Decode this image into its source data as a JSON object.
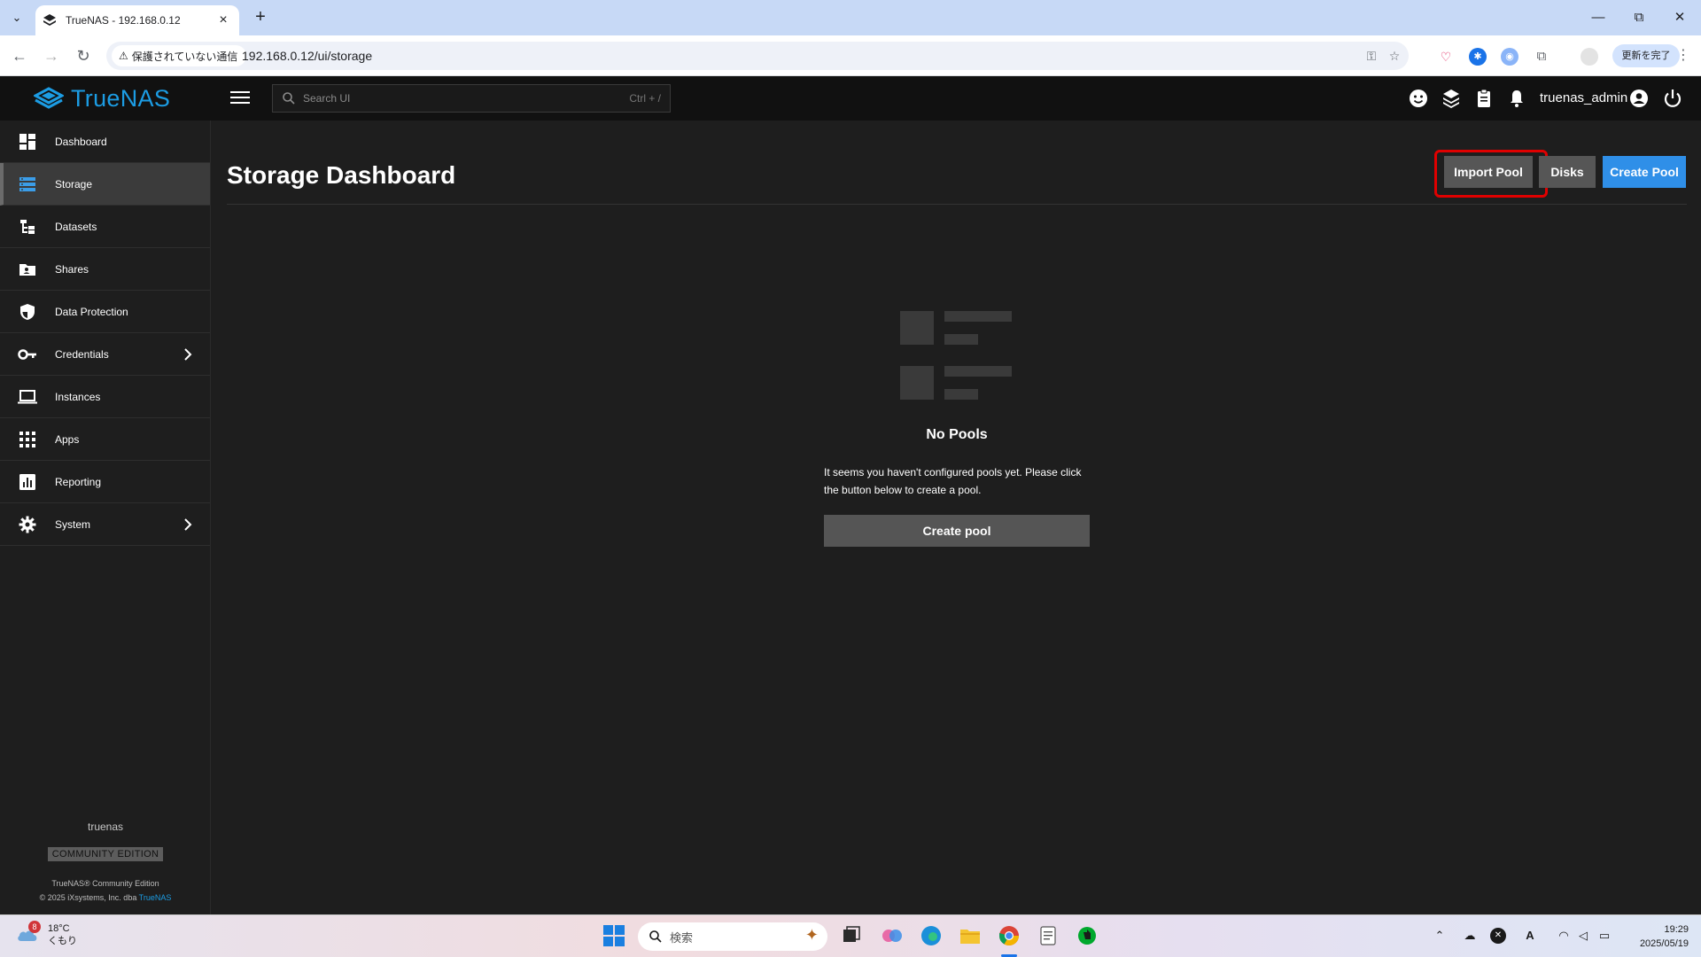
{
  "browser": {
    "tab_title": "TrueNAS - 192.168.0.12",
    "security_label": "保護されていない通信",
    "url": "192.168.0.12/ui/storage",
    "update_button": "更新を完了"
  },
  "header": {
    "logo_text": "TrueNAS",
    "search_placeholder": "Search UI",
    "search_shortcut": "Ctrl + /",
    "username": "truenas_admin"
  },
  "sidebar": {
    "items": [
      {
        "label": "Dashboard",
        "icon": "dashboard-icon"
      },
      {
        "label": "Storage",
        "icon": "storage-icon",
        "active": true
      },
      {
        "label": "Datasets",
        "icon": "datasets-icon"
      },
      {
        "label": "Shares",
        "icon": "shares-icon"
      },
      {
        "label": "Data Protection",
        "icon": "shield-icon"
      },
      {
        "label": "Credentials",
        "icon": "key-icon",
        "expandable": true
      },
      {
        "label": "Instances",
        "icon": "laptop-icon"
      },
      {
        "label": "Apps",
        "icon": "apps-grid-icon"
      },
      {
        "label": "Reporting",
        "icon": "chart-icon"
      },
      {
        "label": "System",
        "icon": "gear-icon",
        "expandable": true
      }
    ],
    "hostname": "truenas",
    "edition": "COMMUNITY EDITION",
    "copyright_line1": "TrueNAS® Community Edition",
    "copyright_line2_prefix": "© 2025 iXsystems, Inc. dba",
    "copyright_brand": "TrueNAS"
  },
  "main": {
    "title": "Storage Dashboard",
    "buttons": {
      "import_pool": "Import Pool",
      "disks": "Disks",
      "create_pool": "Create Pool"
    },
    "empty_state": {
      "title": "No Pools",
      "message": "It seems you haven't configured pools yet. Please click the button below to create a pool.",
      "button": "Create pool"
    }
  },
  "taskbar": {
    "weather_badge": "8",
    "temperature": "18°C",
    "condition": "くもり",
    "search_text": "検索",
    "time": "19:29",
    "date": "2025/05/19"
  },
  "colors": {
    "accent_blue": "#2f8fe8",
    "logo_blue": "#1c9ce3",
    "highlight_red": "#e00000",
    "background": "#1e1e1e",
    "header_bg": "#111111"
  }
}
